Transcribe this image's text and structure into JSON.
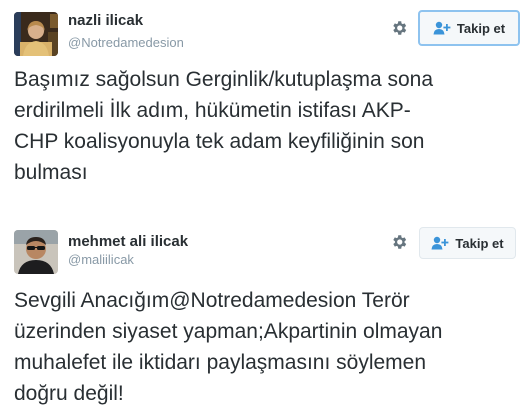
{
  "tweets": [
    {
      "name": "nazli ilicak",
      "handle": "@Notredamedesion",
      "follow_label": "Takip et",
      "text": "Başımız sağolsun Gerginlik/kutuplaşma sona\nerdirilmeli İlk adım, hükümetin istifası AKP-\nCHP koalisyonuyla tek adam keyfiliğinin son\nbulması",
      "avatar_icon": "profile-photo-woman"
    },
    {
      "name": "mehmet ali ilicak",
      "handle": "@maliilicak",
      "follow_label": "Takip et",
      "text": "Sevgili Anacığım@Notredamedesion Terör\nüzerinden siyaset yapman;Akpartinin olmayan\nmuhalefet ile iktidarı paylaşmasını söylemen\ndoğru değil!",
      "avatar_icon": "profile-photo-man"
    }
  ],
  "colors": {
    "text": "#292f33",
    "secondary": "#8899a6",
    "follow_icon": "#3b94d9",
    "focus_border": "#8ec3ef"
  },
  "icons": {
    "gear": "gear-icon",
    "follow": "follow-user-icon"
  }
}
